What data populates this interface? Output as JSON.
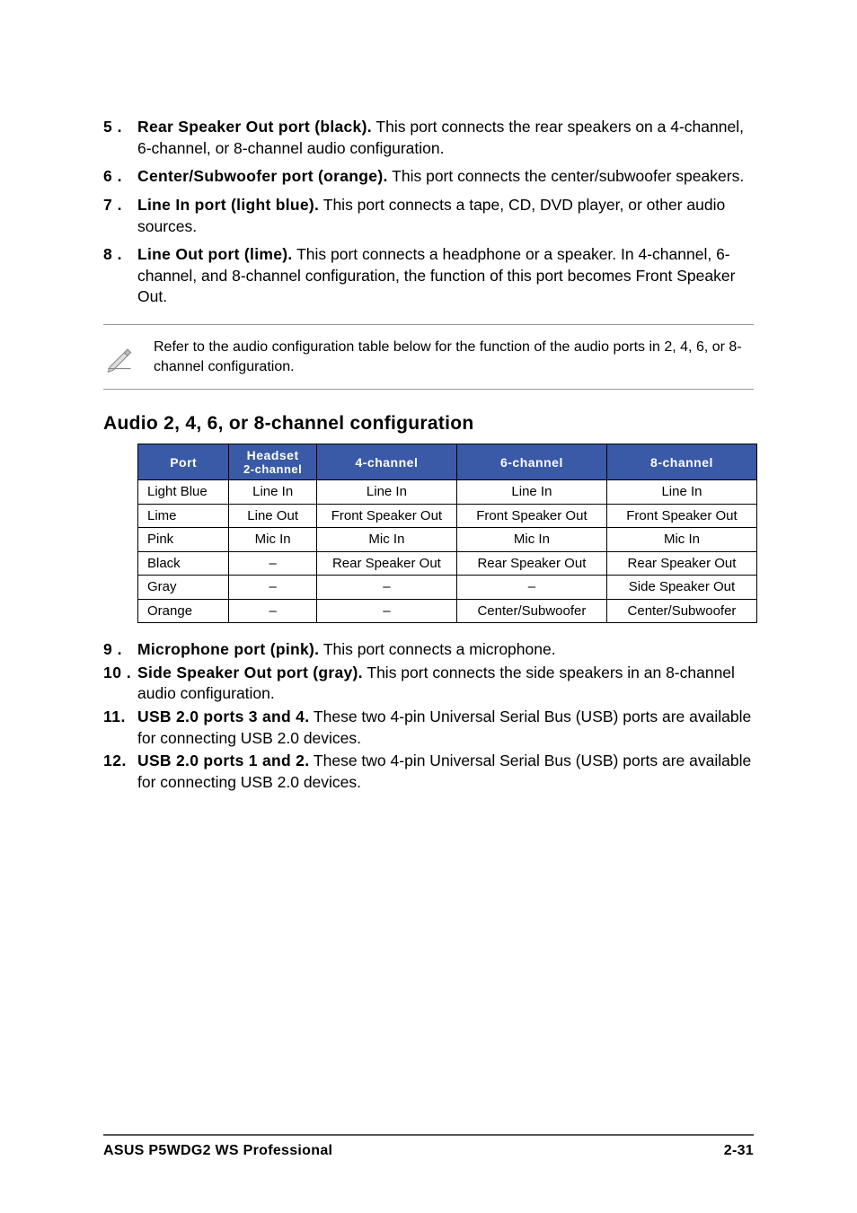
{
  "items": {
    "5": {
      "num": "5 .",
      "title": "Rear Speaker Out port (black).",
      "text": " This port connects the rear speakers on a 4-channel, 6-channel, or 8-channel audio configuration."
    },
    "6": {
      "num": "6 .",
      "title": "Center/Subwoofer port (orange).",
      "text": " This port connects the center/subwoofer speakers."
    },
    "7": {
      "num": "7 .",
      "title": "Line In port (light blue).",
      "text": " This port connects a tape, CD, DVD player, or other audio sources."
    },
    "8": {
      "num": "8 .",
      "title": "Line Out port (lime).",
      "text": " This port connects a headphone or a speaker. In 4-channel, 6-channel, and 8-channel configuration, the function of this port becomes Front Speaker Out."
    },
    "9": {
      "num": "9 .",
      "title": "Microphone port (pink).",
      "text": " This port connects a microphone."
    },
    "10": {
      "num": "10 .",
      "title": "Side Speaker Out port (gray).",
      "text": " This port connects the side speakers in an 8-channel audio configuration."
    },
    "11": {
      "num": "11.",
      "title": " USB 2.0 ports 3 and 4.",
      "text": " These two 4-pin Universal Serial Bus (USB) ports are available for connecting USB 2.0 devices."
    },
    "12": {
      "num": "12.",
      "title": " USB 2.0 ports 1 and 2.",
      "text": " These two 4-pin Universal Serial Bus (USB) ports are available for connecting USB 2.0 devices."
    }
  },
  "note": "Refer to the audio configuration table below for the function of the audio ports in 2, 4, 6, or 8-channel configuration.",
  "section_title": "Audio 2, 4, 6, or 8-channel configuration",
  "table": {
    "headers": {
      "port": "Port",
      "hs1": "Headset",
      "hs2": "2-channel",
      "c4": "4-channel",
      "c6": "6-channel",
      "c8": "8-channel"
    },
    "rows": [
      {
        "port": "Light Blue",
        "hs": "Line In",
        "c4": "Line In",
        "c6": "Line In",
        "c8": "Line In"
      },
      {
        "port": "Lime",
        "hs": "Line Out",
        "c4": "Front Speaker Out",
        "c6": "Front Speaker Out",
        "c8": "Front Speaker Out"
      },
      {
        "port": "Pink",
        "hs": "Mic In",
        "c4": "Mic In",
        "c6": "Mic In",
        "c8": "Mic In"
      },
      {
        "port": "Black",
        "hs": "–",
        "c4": "Rear Speaker Out",
        "c6": "Rear Speaker Out",
        "c8": "Rear Speaker Out"
      },
      {
        "port": "Gray",
        "hs": "–",
        "c4": "–",
        "c6": "–",
        "c8": "Side Speaker Out"
      },
      {
        "port": "Orange",
        "hs": "–",
        "c4": "–",
        "c6": "Center/Subwoofer",
        "c8": "Center/Subwoofer"
      }
    ]
  },
  "footer": {
    "left": "ASUS P5WDG2 WS Professional",
    "right": "2-31"
  }
}
